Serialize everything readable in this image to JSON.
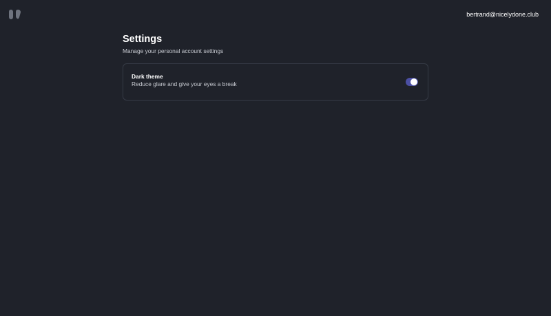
{
  "header": {
    "logo_icon": "quote-marks-logo-icon",
    "user_email": "bertrand@nicelydone.club"
  },
  "main": {
    "title": "Settings",
    "subtitle": "Manage your personal account settings"
  },
  "settings": {
    "dark_theme": {
      "title": "Dark theme",
      "description": "Reduce glare and give your eyes a break",
      "enabled": true
    }
  },
  "colors": {
    "background": "#1f222a",
    "card_border": "#363b46",
    "toggle_on": "#4b4fa3",
    "logo": "#6e737e"
  }
}
